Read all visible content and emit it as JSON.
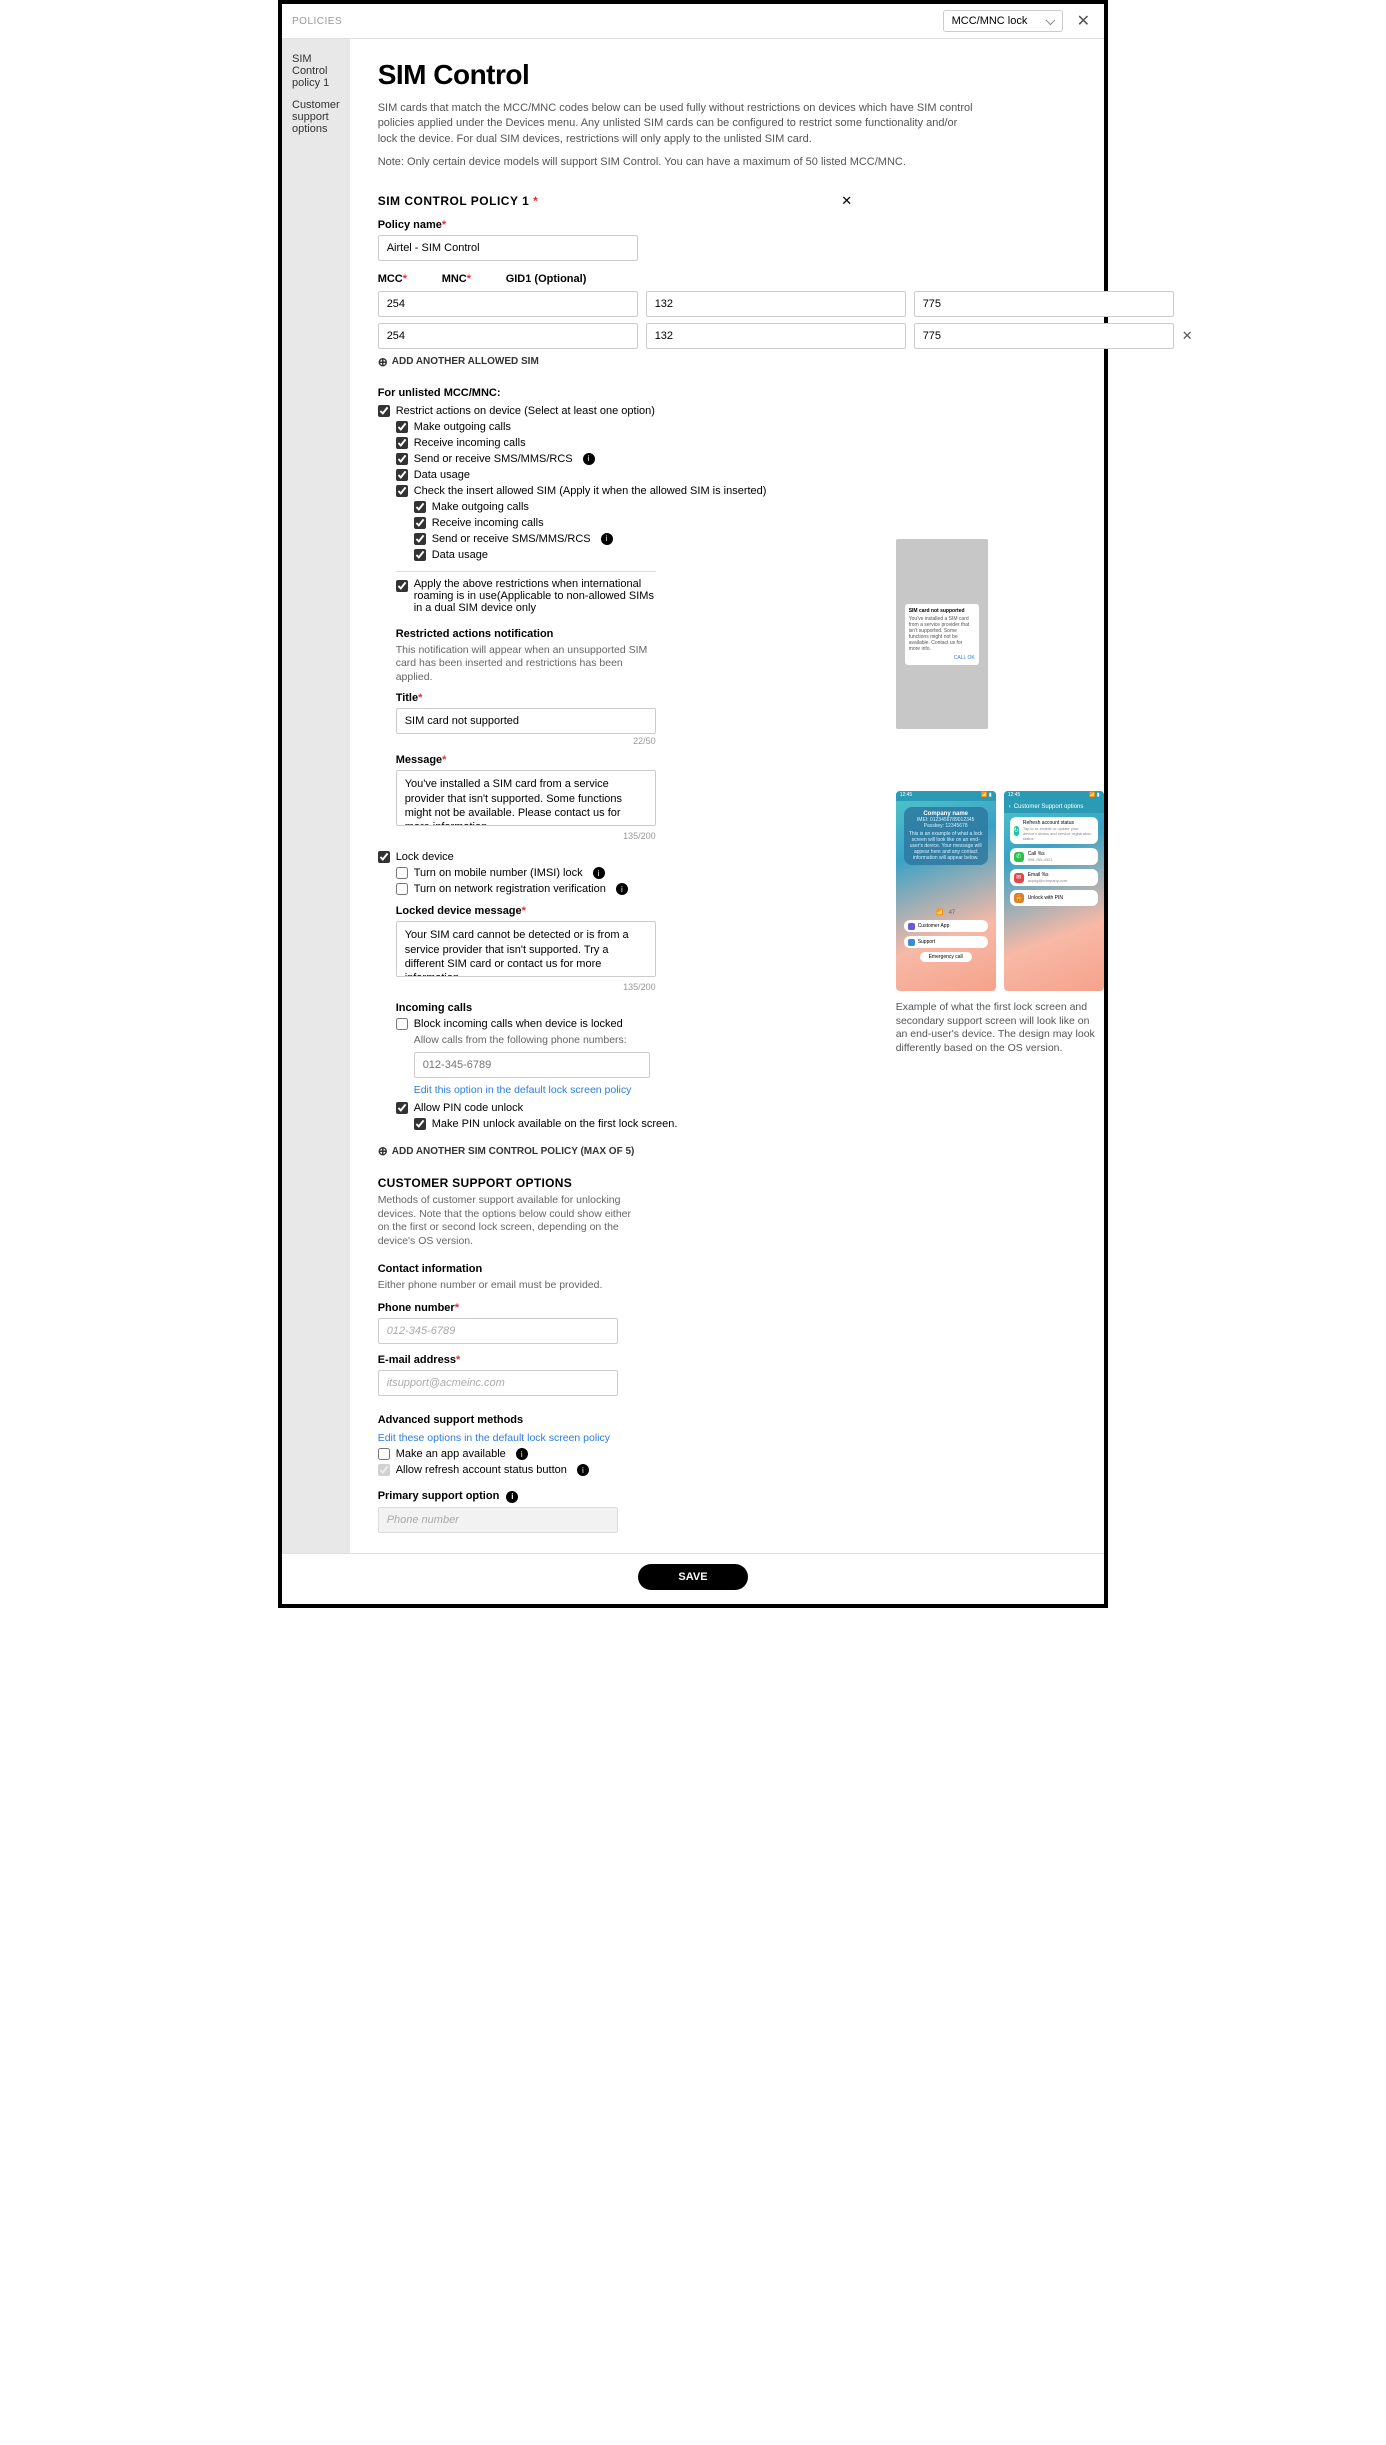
{
  "header": {
    "breadcrumb": "POLICIES",
    "dropdown_value": "MCC/MNC lock"
  },
  "sidebar": {
    "items": [
      "SIM Control policy 1",
      "Customer support options"
    ]
  },
  "page": {
    "title": "SIM Control",
    "intro1": "SIM cards that match the MCC/MNC codes below can be used fully without restrictions on devices which have SIM control policies applied under the Devices menu. Any unlisted SIM cards can be configured to restrict some functionality and/or lock the device. For dual SIM devices, restrictions will only apply to the unlisted SIM card.",
    "intro2": "Note: Only certain device models will support SIM Control. You can have a maximum of 50 listed MCC/MNC."
  },
  "policy": {
    "section_title": "SIM CONTROL POLICY 1",
    "name_label": "Policy name",
    "name_value": "Airtel - SIM Control",
    "cols": {
      "mcc": "MCC",
      "mnc": "MNC",
      "gid": "GID1 (Optional)"
    },
    "rows": [
      {
        "mcc": "254",
        "mnc": "132",
        "gid": "775"
      },
      {
        "mcc": "254",
        "mnc": "132",
        "gid": "775"
      }
    ],
    "add_sim": "ADD ANOTHER ALLOWED SIM"
  },
  "unlisted": {
    "heading": "For unlisted MCC/MNC:",
    "restrict_label": "Restrict actions on device (Select at least one option)",
    "actions": {
      "outgoing": "Make outgoing calls",
      "incoming": "Receive incoming calls",
      "sms": "Send or receive SMS/MMS/RCS",
      "data": "Data usage",
      "check_insert": "Check the insert allowed SIM (Apply it when the allowed SIM is inserted)"
    },
    "roaming": "Apply the above restrictions when international roaming is in use(Applicable to non-allowed SIMs in a dual SIM device only"
  },
  "restricted_notif": {
    "heading": "Restricted actions notification",
    "sub": "This notification will appear when an unsupported SIM card has been inserted and restrictions has been applied.",
    "title_label": "Title",
    "title_value": "SIM card not supported",
    "title_counter": "22/50",
    "msg_label": "Message",
    "msg_value": "You've installed a SIM card from a service provider that isn't supported. Some functions might not be available. Please contact us for more information.",
    "msg_counter": "135/200"
  },
  "lock": {
    "label": "Lock device",
    "imsi": "Turn on mobile number (IMSI) lock",
    "net_reg": "Turn on network registration verification",
    "locked_msg_label": "Locked device message",
    "locked_msg_value": "Your SIM card cannot be detected or is from a service provider that isn't supported. Try a different SIM card or contact us for more information.",
    "locked_counter": "135/200"
  },
  "incoming": {
    "heading": "Incoming calls",
    "block": "Block incoming calls when device is locked",
    "allow_from": "Allow calls from the following phone numbers:",
    "placeholder": "012-345-6789",
    "edit_link": "Edit this option in the default lock screen policy",
    "allow_pin": "Allow PIN code unlock",
    "make_pin": "Make PIN unlock available on the first lock screen."
  },
  "add_policy": "ADD ANOTHER SIM CONTROL POLICY  (MAX OF 5)",
  "cs": {
    "heading": "CUSTOMER SUPPORT OPTIONS",
    "sub": "Methods of customer support available for unlocking devices. Note that the options below could show either on the first or second lock screen, depending on the device's OS version.",
    "contact_heading": "Contact information",
    "contact_sub": "Either phone number or email must be provided.",
    "phone_label": "Phone number",
    "phone_placeholder": "012-345-6789",
    "email_label": "E-mail address",
    "email_placeholder": "itsupport@acmeinc.com",
    "adv_heading": "Advanced support methods",
    "adv_link": "Edit these options in the default lock screen policy",
    "make_app": "Make an app available",
    "refresh": "Allow refresh account status button",
    "primary_label": "Primary support option",
    "primary_value": "Phone number"
  },
  "preview_notif": {
    "title": "SIM card not supported",
    "body": "You've installed a SIM card from a service provider that isn't supported. Some functions might not be available. Contact us for more info.",
    "footer": "CALL    OK"
  },
  "phones_caption": "Example of what the first lock screen and secondary support screen will look like on an end-user's device. The design may look differently based on the OS version.",
  "phone1": {
    "company": "Company name",
    "imei": "IMEI: 0123456789012345",
    "passkey": "Passkey: 12345678",
    "msg": "This is an example of what a lock screen will look like on an end-user's device. Your message will appear here and any contact information will appear below.",
    "pill1": "Customer App",
    "pill2": "Support",
    "emergency": "Emergency call"
  },
  "phone2": {
    "title": "Customer Support options",
    "opts": [
      {
        "label": "Refresh account status",
        "sub": "Tap to re-enable or update your device's status and service registration status"
      },
      {
        "label": "Call %s",
        "sub": "098-765-4321"
      },
      {
        "label": "Email %s",
        "sub": "acpsg@company.com"
      },
      {
        "label": "Unlock with PIN",
        "sub": ""
      }
    ]
  },
  "footer": {
    "save": "SAVE"
  }
}
